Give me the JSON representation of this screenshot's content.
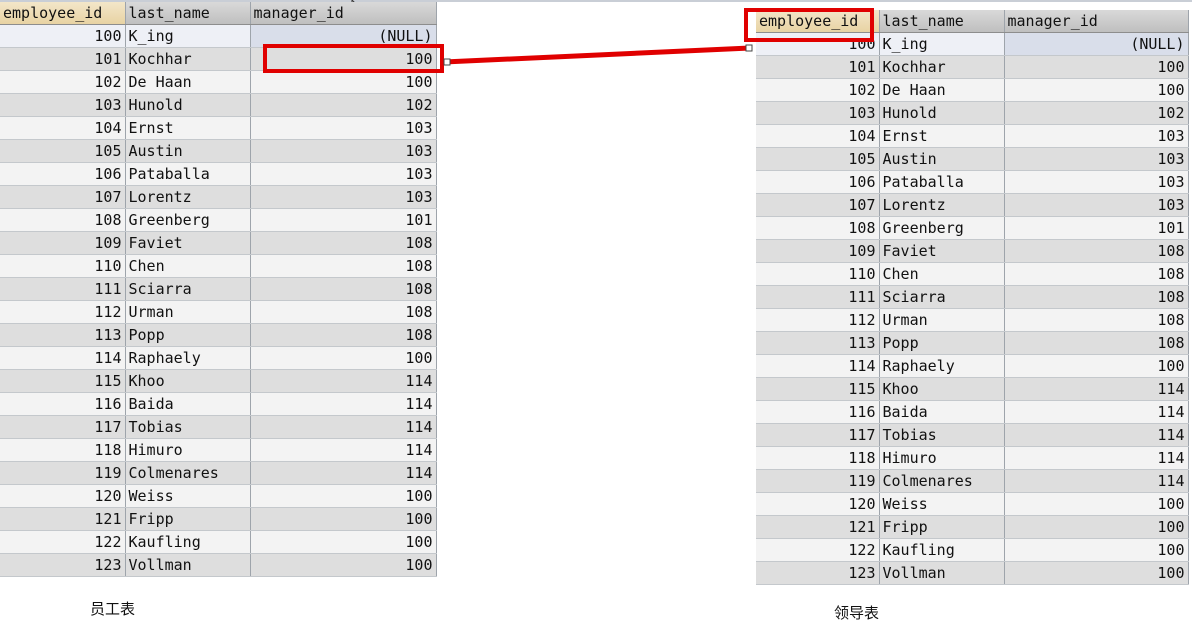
{
  "columns": [
    "employee_id",
    "last_name",
    "manager_id"
  ],
  "rows": [
    {
      "employee_id": "100",
      "last_name": "K_ing",
      "manager_id": "(NULL)"
    },
    {
      "employee_id": "101",
      "last_name": "Kochhar",
      "manager_id": "100"
    },
    {
      "employee_id": "102",
      "last_name": "De Haan",
      "manager_id": "100"
    },
    {
      "employee_id": "103",
      "last_name": "Hunold",
      "manager_id": "102"
    },
    {
      "employee_id": "104",
      "last_name": "Ernst",
      "manager_id": "103"
    },
    {
      "employee_id": "105",
      "last_name": "Austin",
      "manager_id": "103"
    },
    {
      "employee_id": "106",
      "last_name": "Pataballa",
      "manager_id": "103"
    },
    {
      "employee_id": "107",
      "last_name": "Lorentz",
      "manager_id": "103"
    },
    {
      "employee_id": "108",
      "last_name": "Greenberg",
      "manager_id": "101"
    },
    {
      "employee_id": "109",
      "last_name": "Faviet",
      "manager_id": "108"
    },
    {
      "employee_id": "110",
      "last_name": "Chen",
      "manager_id": "108"
    },
    {
      "employee_id": "111",
      "last_name": "Sciarra",
      "manager_id": "108"
    },
    {
      "employee_id": "112",
      "last_name": "Urman",
      "manager_id": "108"
    },
    {
      "employee_id": "113",
      "last_name": "Popp",
      "manager_id": "108"
    },
    {
      "employee_id": "114",
      "last_name": "Raphaely",
      "manager_id": "100"
    },
    {
      "employee_id": "115",
      "last_name": "Khoo",
      "manager_id": "114"
    },
    {
      "employee_id": "116",
      "last_name": "Baida",
      "manager_id": "114"
    },
    {
      "employee_id": "117",
      "last_name": "Tobias",
      "manager_id": "114"
    },
    {
      "employee_id": "118",
      "last_name": "Himuro",
      "manager_id": "114"
    },
    {
      "employee_id": "119",
      "last_name": "Colmenares",
      "manager_id": "114"
    },
    {
      "employee_id": "120",
      "last_name": "Weiss",
      "manager_id": "100"
    },
    {
      "employee_id": "121",
      "last_name": "Fripp",
      "manager_id": "100"
    },
    {
      "employee_id": "122",
      "last_name": "Kaufling",
      "manager_id": "100"
    },
    {
      "employee_id": "123",
      "last_name": "Vollman",
      "manager_id": "100"
    }
  ],
  "captions": {
    "employee_table": "员工表",
    "manager_table": "领导表"
  },
  "colors": {
    "highlight": "#e00000",
    "header_sorted": "#f3e6c9"
  },
  "icons": {
    "cursor": "mouse-pointer-icon"
  }
}
